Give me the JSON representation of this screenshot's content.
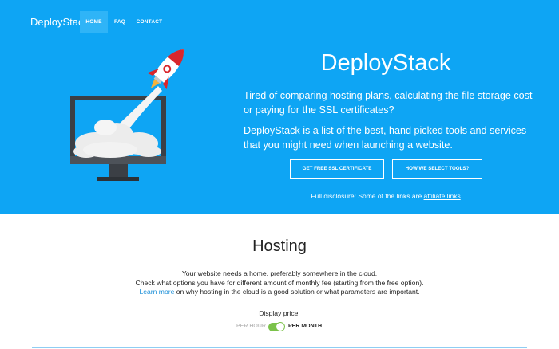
{
  "nav": {
    "brand": "DeployStack",
    "items": [
      {
        "label": "HOME"
      },
      {
        "label": "FAQ"
      },
      {
        "label": "CONTACT"
      }
    ]
  },
  "hero": {
    "title": "DeployStack",
    "paragraph1": "Tired of comparing hosting plans, calculating the file storage cost or paying for the SSL certificates?",
    "paragraph2": "DeployStack is a list of the best, hand picked tools and services that you might need when launching a website.",
    "button_ssl": "GET FREE SSL CERTIFICATE",
    "button_tools": "HOW WE SELECT TOOLS?",
    "disclosure_text": "Full disclosure: Some of the links are ",
    "disclosure_link": "affiliate links"
  },
  "hosting": {
    "title": "Hosting",
    "line1": "Your website needs a home, preferably somewhere in the cloud.",
    "line2": "Check what options you have for different amount of monthly fee (starting from the free option).",
    "learn_more": "Learn more",
    "line3_rest": " on why hosting in the cloud is a good solution or what parameters are important.",
    "display_price_label": "Display price:",
    "toggle_left": "PER HOUR",
    "toggle_right": "PER MONTH",
    "toggle_state": "per-month"
  },
  "colors": {
    "hero_bg": "#0ea5f4",
    "nav_active_bg": "#2fb4f7",
    "toggle_on": "#7bc24a",
    "link": "#1a8fd8",
    "rocket_red": "#d9262c"
  }
}
